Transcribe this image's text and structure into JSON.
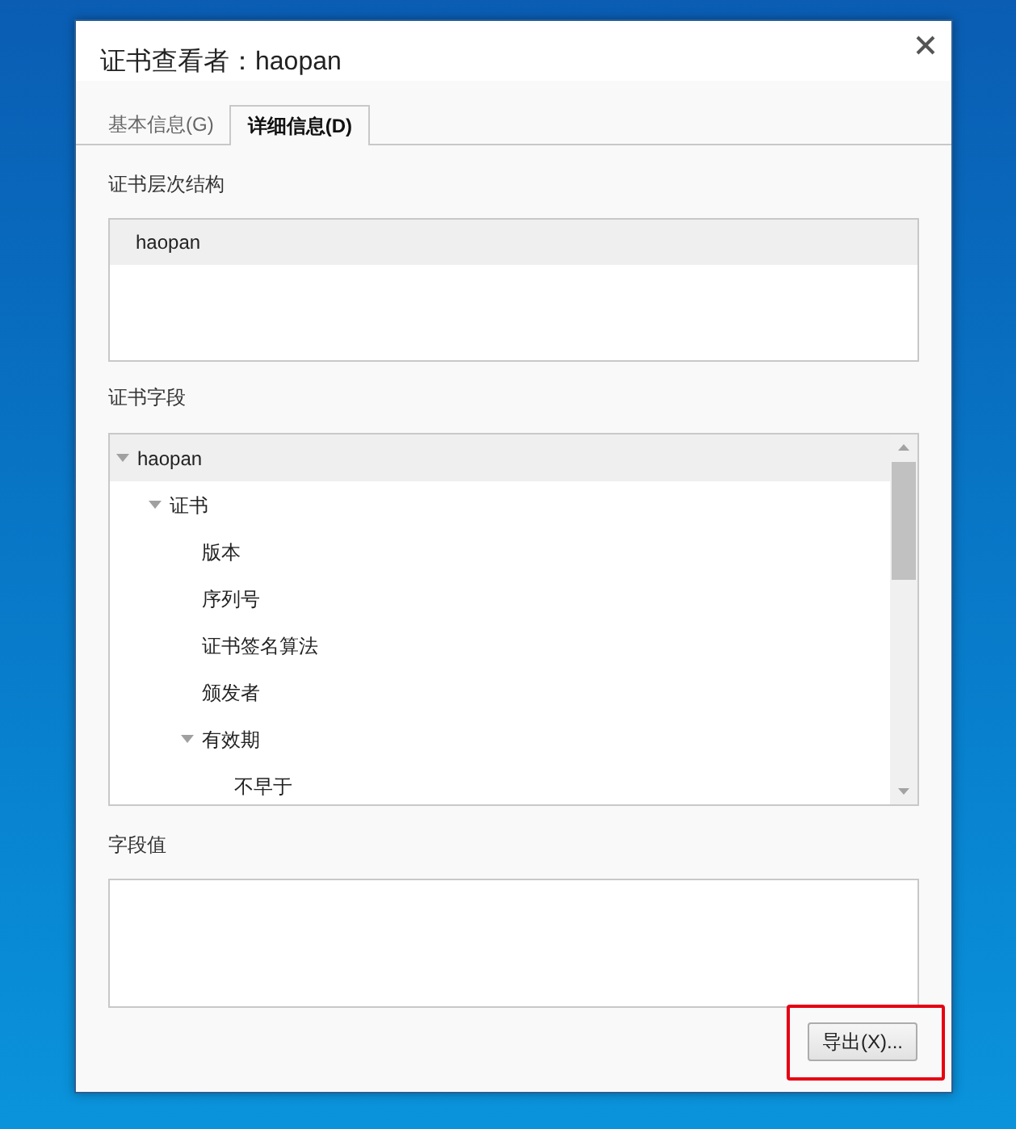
{
  "dialog": {
    "title": "证书查看者：haopan"
  },
  "tabs": [
    {
      "label": "基本信息(G)",
      "selected": false
    },
    {
      "label": "详细信息(D)",
      "selected": true
    }
  ],
  "hierarchy": {
    "label": "证书层次结构",
    "items": [
      {
        "label": "haopan",
        "selected": true
      }
    ]
  },
  "fields": {
    "label": "证书字段",
    "tree": [
      {
        "label": "haopan",
        "selected": true,
        "expanded": true,
        "children": [
          {
            "label": "证书",
            "selected": false,
            "expanded": true,
            "children": [
              {
                "label": "版本",
                "selected": false
              },
              {
                "label": "序列号",
                "selected": false
              },
              {
                "label": "证书签名算法",
                "selected": false
              },
              {
                "label": "颁发者",
                "selected": false
              },
              {
                "label": "有效期",
                "selected": false,
                "expanded": true,
                "children": [
                  {
                    "label": "不早于",
                    "selected": false
                  }
                ]
              }
            ]
          }
        ]
      }
    ]
  },
  "field_value": {
    "label": "字段值"
  },
  "export_button": {
    "label": "导出(X)...",
    "highlighted": true
  }
}
